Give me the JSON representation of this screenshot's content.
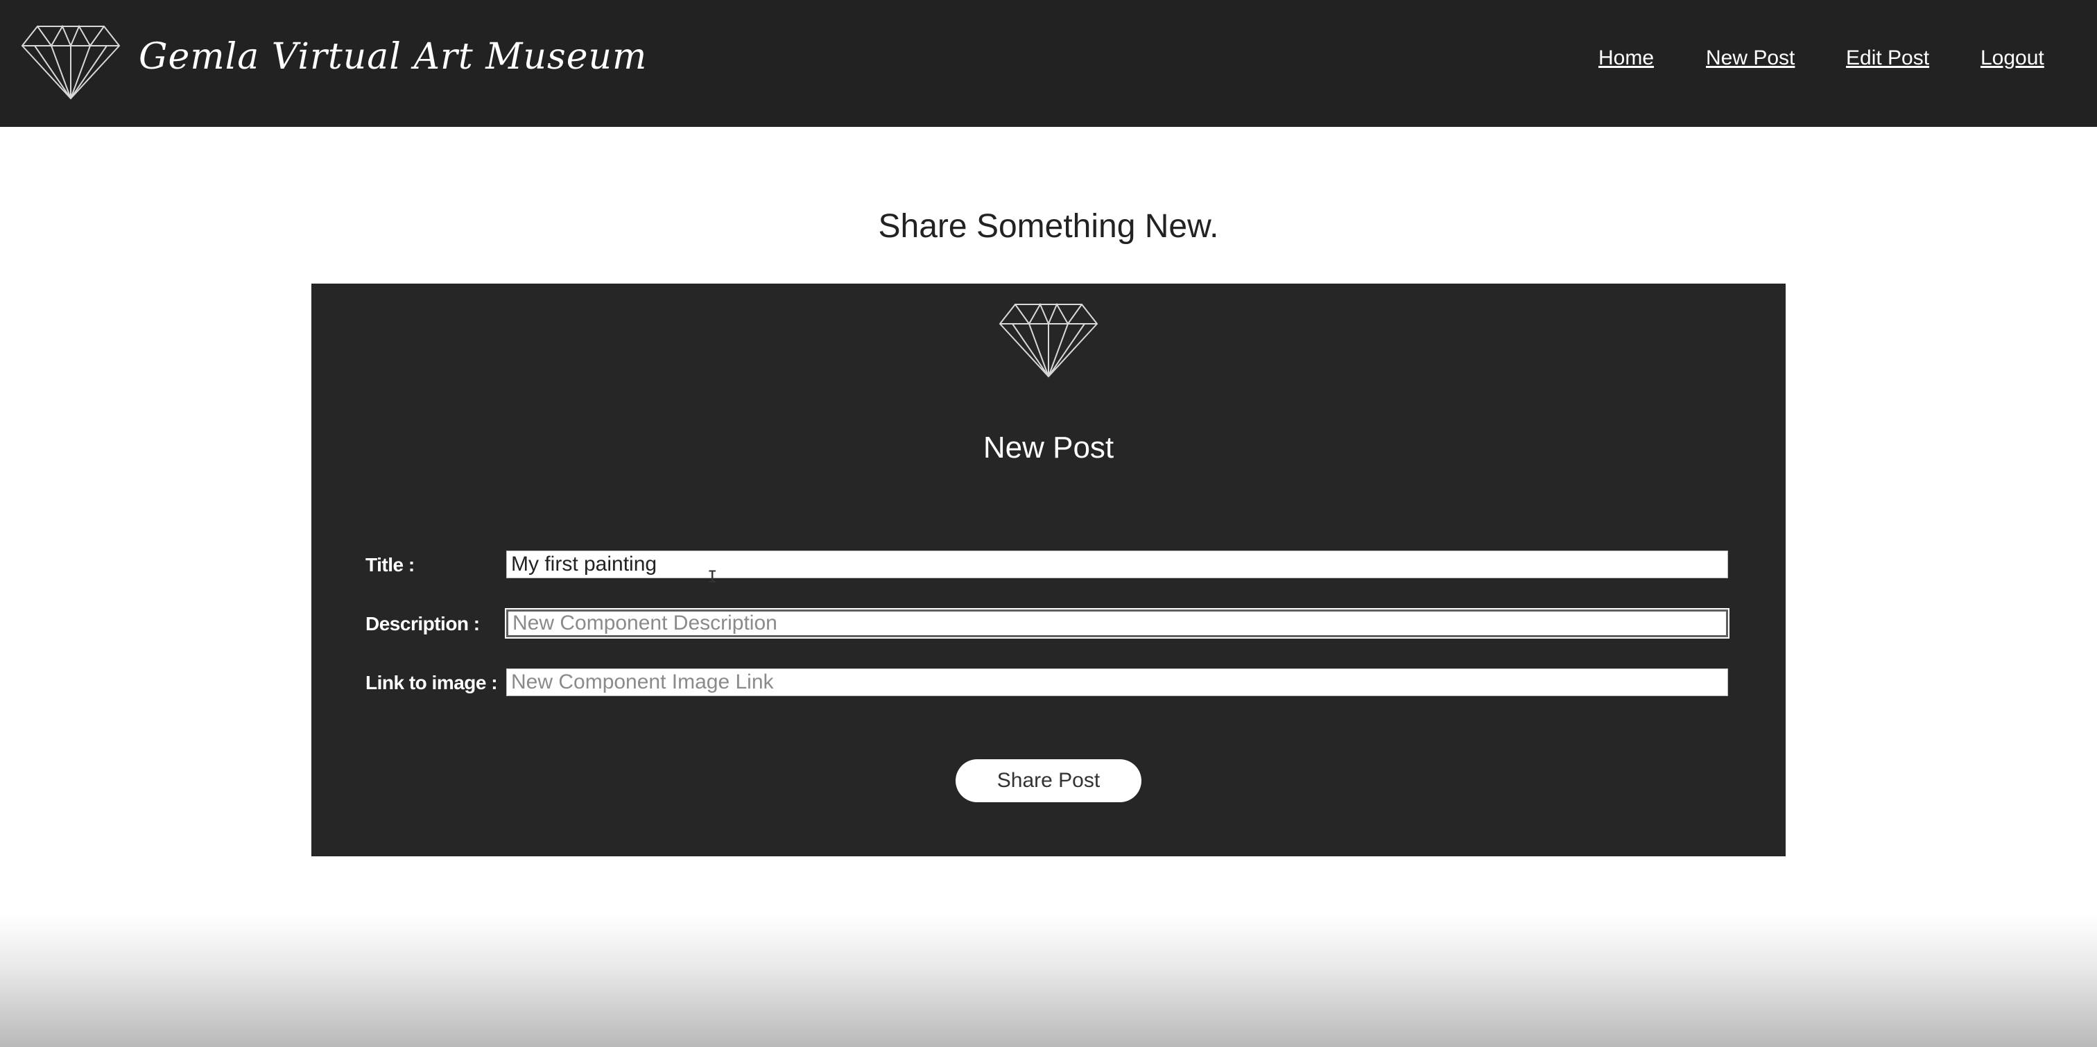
{
  "header": {
    "site_title": "Gemla Virtual Art Museum",
    "logo_icon": "diamond-icon",
    "nav": {
      "home": "Home",
      "new_post": "New Post",
      "edit_post": "Edit Post",
      "logout": "Logout"
    }
  },
  "page": {
    "heading": "Share Something New."
  },
  "form": {
    "icon": "diamond-icon",
    "title": "New Post",
    "fields": {
      "title": {
        "label": "Title :",
        "value": "My first painting",
        "placeholder": ""
      },
      "description": {
        "label": "Description :",
        "value": "",
        "placeholder": "New Component Description"
      },
      "image_link": {
        "label": "Link to image :",
        "value": "",
        "placeholder": "New Component Image Link"
      }
    },
    "submit_label": "Share Post"
  },
  "colors": {
    "header_bg": "#222222",
    "card_bg": "#262626",
    "text_light": "#ffffff",
    "text_dark": "#222222"
  }
}
